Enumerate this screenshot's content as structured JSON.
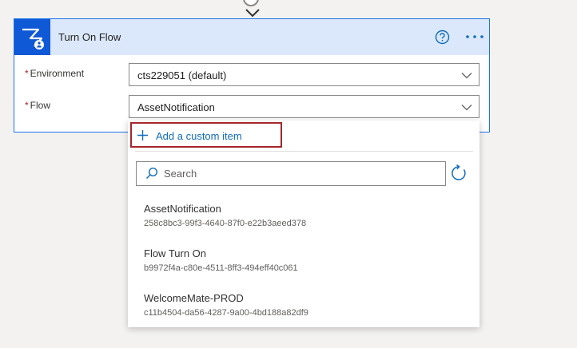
{
  "action": {
    "title": "Turn On Flow"
  },
  "fields": [
    {
      "label": "Environment",
      "value": "cts229051 (default)"
    },
    {
      "label": "Flow",
      "value": "AssetNotification"
    }
  ],
  "required_marker": "*",
  "dropdown": {
    "custom_item_label": "Add a custom item",
    "search_placeholder": "Search",
    "items": [
      {
        "name": "AssetNotification",
        "id": "258c8bc3-99f3-4640-87f0-e22b3aeed378"
      },
      {
        "name": "Flow Turn On",
        "id": "b9972f4a-c80e-4511-8ff3-494eff40c061"
      },
      {
        "name": "WelcomeMate-PROD",
        "id": "c11b4504-da56-4287-9a00-4bd188a82df9"
      }
    ]
  },
  "icons": {
    "header": [
      "help-icon",
      "more-icon"
    ],
    "app": "power-automate-icon"
  },
  "colors": {
    "accent": "#0f6cbd",
    "header_bg": "#dbe8fb",
    "app_icon_bg": "#0f58d6",
    "highlight_border": "#a4262c"
  }
}
